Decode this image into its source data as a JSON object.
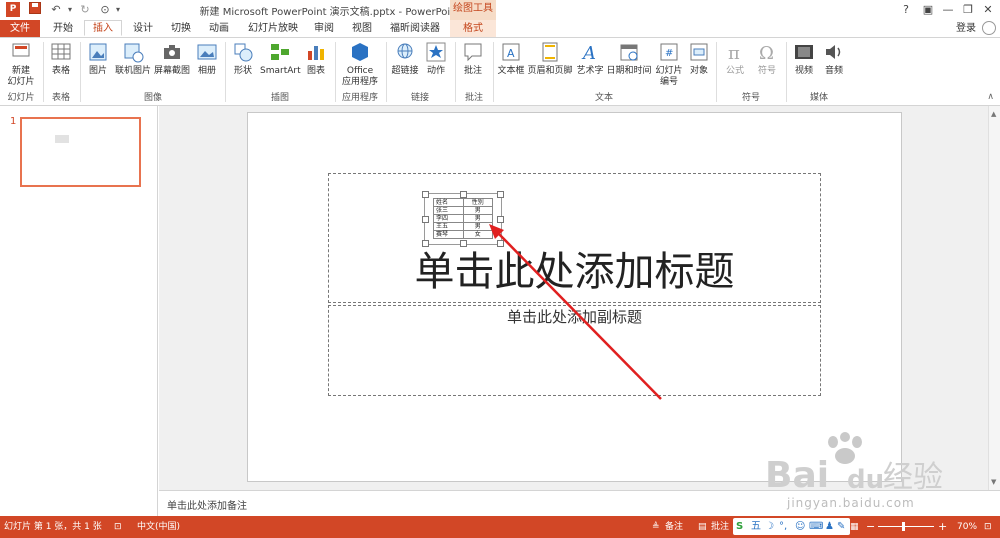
{
  "window": {
    "title": "新建 Microsoft PowerPoint 演示文稿.pptx - PowerPoint",
    "context_group": "绘图工具",
    "help": "?",
    "minimize": "—",
    "restore": "❐",
    "close": "✕"
  },
  "tabs": [
    {
      "label": "文件"
    },
    {
      "label": "开始"
    },
    {
      "label": "插入"
    },
    {
      "label": "设计"
    },
    {
      "label": "切换"
    },
    {
      "label": "动画"
    },
    {
      "label": "幻灯片放映"
    },
    {
      "label": "审阅"
    },
    {
      "label": "视图"
    },
    {
      "label": "福昕阅读器"
    },
    {
      "label": "格式"
    }
  ],
  "login": "登录",
  "ribbon": {
    "groups": [
      {
        "label": "幻灯片"
      },
      {
        "label": "表格"
      },
      {
        "label": "图像"
      },
      {
        "label": "插图"
      },
      {
        "label": "应用程序"
      },
      {
        "label": "链接"
      },
      {
        "label": "批注"
      },
      {
        "label": "文本"
      },
      {
        "label": "符号"
      },
      {
        "label": "媒体"
      }
    ],
    "buttons": [
      {
        "label": "新建\n幻灯片"
      },
      {
        "label": "表格"
      },
      {
        "label": "图片"
      },
      {
        "label": "联机图片"
      },
      {
        "label": "屏幕截图"
      },
      {
        "label": "相册"
      },
      {
        "label": "形状"
      },
      {
        "label": "SmartArt"
      },
      {
        "label": "图表"
      },
      {
        "label": "Office\n应用程序"
      },
      {
        "label": "超链接"
      },
      {
        "label": "动作"
      },
      {
        "label": "批注"
      },
      {
        "label": "文本框"
      },
      {
        "label": "页眉和页脚"
      },
      {
        "label": "艺术字"
      },
      {
        "label": "日期和时间"
      },
      {
        "label": "幻灯片\n编号"
      },
      {
        "label": "对象"
      },
      {
        "label": "公式"
      },
      {
        "label": "符号"
      },
      {
        "label": "视频"
      },
      {
        "label": "音频"
      }
    ]
  },
  "thumbnails": [
    {
      "number": "1"
    }
  ],
  "slide": {
    "title_placeholder": "单击此处添加标题",
    "subtitle_placeholder": "单击此处添加副标题",
    "table": {
      "headers": [
        "姓名",
        "性别"
      ],
      "rows": [
        [
          "张三",
          "男"
        ],
        [
          "李四",
          "男"
        ],
        [
          "王五",
          "男"
        ],
        [
          "赛琴",
          "女"
        ]
      ]
    }
  },
  "notes": {
    "placeholder": "单击此处添加备注"
  },
  "status": {
    "slide_info": "幻灯片 第 1 张，共 1 张",
    "language": "中文(中国)",
    "notes_btn": "备注",
    "comments_btn": "批注",
    "zoom": "70%"
  },
  "watermark": {
    "brand": "Bai",
    "du": "du",
    "cn": "经验",
    "url": "jingyan.baidu.com"
  },
  "colors": {
    "accent": "#d24726",
    "arrow": "#e02020"
  }
}
